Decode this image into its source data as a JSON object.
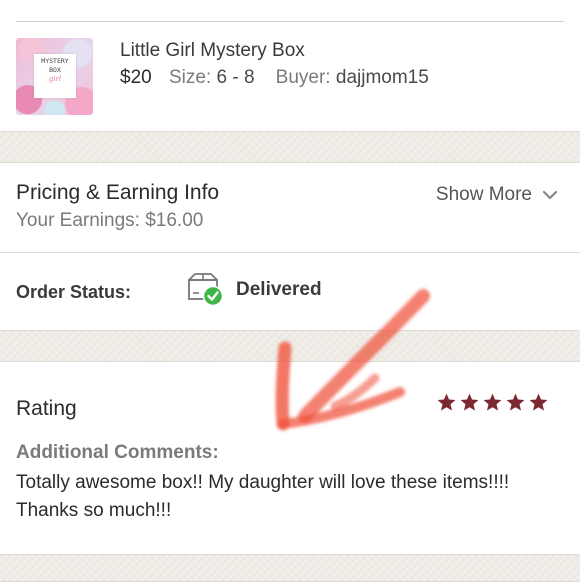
{
  "item": {
    "title": "Little Girl Mystery Box",
    "price": "$20",
    "size_label": "Size:",
    "size_value": "6 - 8",
    "buyer_label": "Buyer:",
    "buyer_value": "dajjmom15",
    "thumbnail": {
      "line1": "MYSTERY",
      "line2": "BOX",
      "line3": "girl"
    }
  },
  "pricing": {
    "title": "Pricing & Earning Info",
    "earnings": "Your Earnings: $16.00",
    "show_more_label": "Show More",
    "show_more_icon": "chevron-down-icon"
  },
  "order": {
    "status_label": "Order Status:",
    "status_value": "Delivered",
    "status_icon": "package-delivered-icon",
    "status_color": "#3fb64a"
  },
  "rating": {
    "title": "Rating",
    "stars": 5,
    "max_stars": 5,
    "star_color": "#7d2733",
    "comments_label": "Additional Comments:",
    "comments_text": "Totally awesome box!! My daughter will love these items!!!! Thanks so much!!!"
  },
  "annotation": {
    "arrow_icon": "arrow-annotation",
    "arrow_color": "#f0503a"
  }
}
